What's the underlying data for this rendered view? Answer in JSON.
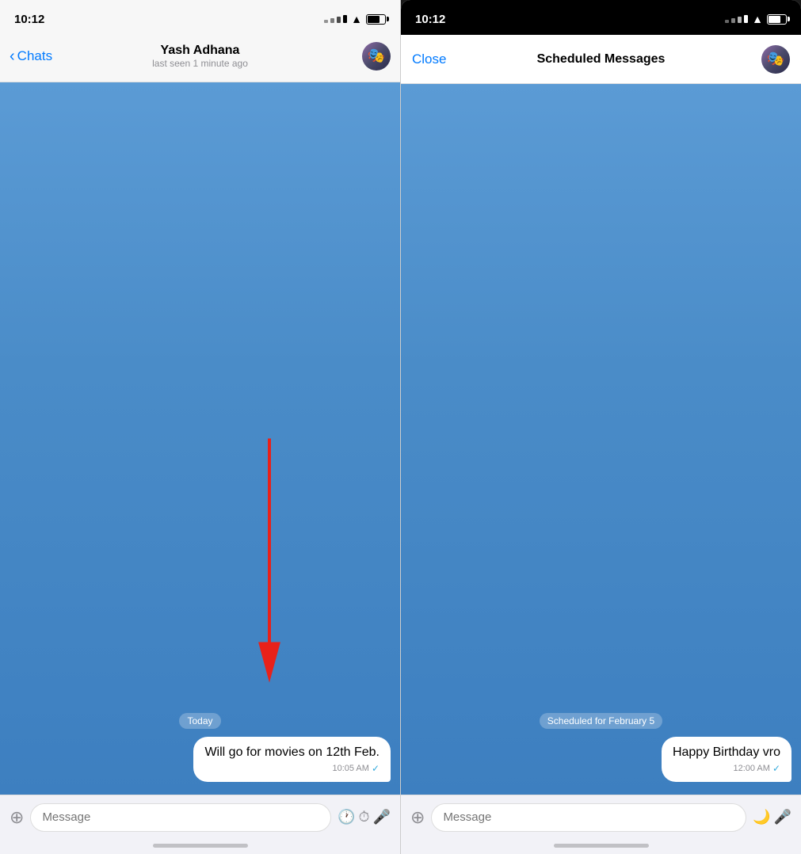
{
  "left_panel": {
    "status_time": "10:12",
    "nav": {
      "back_label": "Chats",
      "contact_name": "Yash Adhana",
      "last_seen": "last seen 1 minute ago"
    },
    "messages": [
      {
        "type": "date",
        "label": "Today"
      },
      {
        "type": "sent",
        "text": "Will go for movies on 12th Feb.",
        "time": "10:05 AM",
        "check": "✓"
      }
    ],
    "input": {
      "placeholder": "Message"
    }
  },
  "right_panel": {
    "status_time": "10:12",
    "nav": {
      "close_label": "Close",
      "title": "Scheduled Messages"
    },
    "messages": [
      {
        "type": "scheduled",
        "label": "Scheduled for February 5"
      },
      {
        "type": "sent",
        "text": "Happy Birthday vro",
        "time": "12:00 AM",
        "check": "✓"
      }
    ],
    "input": {
      "placeholder": "Message"
    }
  },
  "icons": {
    "attachment": "📎",
    "schedule_clock": "🕐",
    "timer_clock": "⏱",
    "microphone": "🎤",
    "moon": "🌙"
  }
}
